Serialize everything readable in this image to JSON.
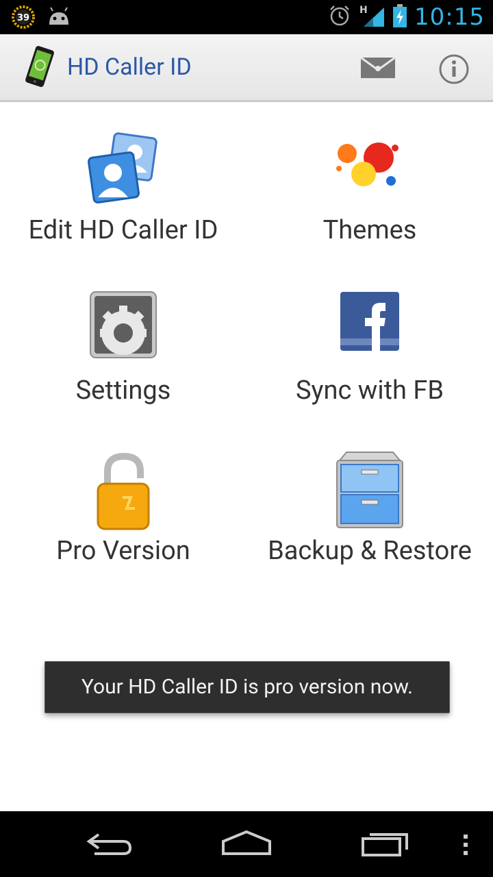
{
  "status": {
    "battery_badge": "39",
    "network_letter": "H",
    "time": "10:15",
    "accent": "#33b5e5"
  },
  "actionbar": {
    "title": "HD Caller ID",
    "icons": [
      "phone-app-icon",
      "mail-icon",
      "info-icon"
    ]
  },
  "menu": {
    "items": [
      {
        "label": "Edit HD Caller ID",
        "icon": "contacts-icon"
      },
      {
        "label": "Themes",
        "icon": "paint-splash-icon"
      },
      {
        "label": "Settings",
        "icon": "gear-icon"
      },
      {
        "label": "Sync with FB",
        "icon": "facebook-icon"
      },
      {
        "label": "Pro Version",
        "icon": "unlocked-padlock-icon"
      },
      {
        "label": "Backup & Restore",
        "icon": "file-cabinet-icon"
      }
    ]
  },
  "toast": {
    "message": "Your HD Caller ID is pro version now."
  },
  "navbar": {
    "icons": [
      "back-icon",
      "home-icon",
      "recents-icon",
      "overflow-menu-icon"
    ]
  }
}
